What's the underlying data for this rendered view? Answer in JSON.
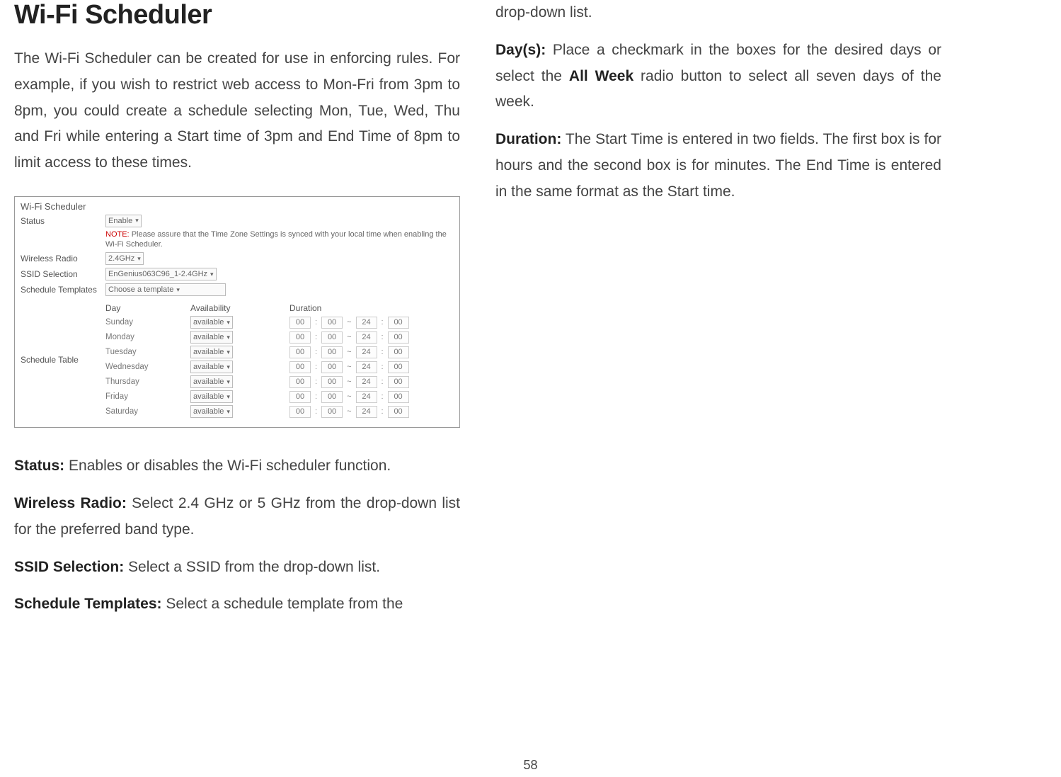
{
  "page_number": "58",
  "left": {
    "heading": "Wi-Fi Scheduler",
    "intro": "The Wi-Fi Scheduler can be created for use in enforcing rules. For example, if you wish to restrict web access to Mon-Fri from 3pm to 8pm, you could create a schedule selecting Mon, Tue, Wed, Thu and Fri while entering a Start time of 3pm and End Time of 8pm to limit access to these times.",
    "figure": {
      "title": "Wi-Fi Scheduler",
      "status_label": "Status",
      "status_value": "Enable",
      "note_label": "NOTE:",
      "note_text": "Please assure that the Time Zone Settings is synced with your local time when enabling the Wi-Fi Scheduler.",
      "radio_label": "Wireless Radio",
      "radio_value": "2.4GHz",
      "ssid_label": "SSID Selection",
      "ssid_value": "EnGenius063C96_1-2.4GHz",
      "template_label": "Schedule Templates",
      "template_value": "Choose a template",
      "table_label": "Schedule Table",
      "head_day": "Day",
      "head_av": "Availability",
      "head_dur": "Duration",
      "rows": [
        {
          "day": "Sunday",
          "av": "available",
          "h1": "00",
          "m1": "00",
          "h2": "24",
          "m2": "00"
        },
        {
          "day": "Monday",
          "av": "available",
          "h1": "00",
          "m1": "00",
          "h2": "24",
          "m2": "00"
        },
        {
          "day": "Tuesday",
          "av": "available",
          "h1": "00",
          "m1": "00",
          "h2": "24",
          "m2": "00"
        },
        {
          "day": "Wednesday",
          "av": "available",
          "h1": "00",
          "m1": "00",
          "h2": "24",
          "m2": "00"
        },
        {
          "day": "Thursday",
          "av": "available",
          "h1": "00",
          "m1": "00",
          "h2": "24",
          "m2": "00"
        },
        {
          "day": "Friday",
          "av": "available",
          "h1": "00",
          "m1": "00",
          "h2": "24",
          "m2": "00"
        },
        {
          "day": "Saturday",
          "av": "available",
          "h1": "00",
          "m1": "00",
          "h2": "24",
          "m2": "00"
        }
      ]
    },
    "p_status_b": "Status:",
    "p_status_t": " Enables or disables the Wi-Fi scheduler function.",
    "p_radio_b": "Wireless Radio:",
    "p_radio_t": " Select 2.4 GHz or 5 GHz from the drop-down list for the preferred band type.",
    "p_ssid_b": "SSID Selection:",
    "p_ssid_t": " Select a SSID from the drop-down list.",
    "p_tmpl_b": "Schedule Templates:",
    "p_tmpl_t": " Select a schedule template from the"
  },
  "right": {
    "p_cont": "drop-down list.",
    "p_day_b": "Day(s):",
    "p_day_t1": " Place a checkmark in the boxes for the desired days or select the ",
    "p_day_bold2": "All Week",
    "p_day_t2": " radio button to select all seven days of the week.",
    "p_dur_b": "Duration:",
    "p_dur_t": " The Start Time is entered in two fields. The first box is for hours and the second box is for minutes. The End Time is entered in the same format as the Start time."
  }
}
